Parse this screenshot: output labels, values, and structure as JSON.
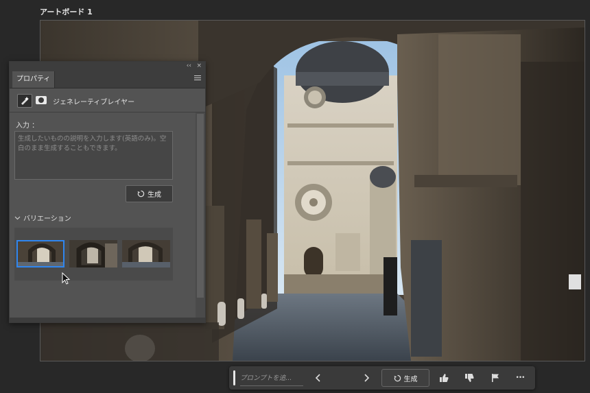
{
  "artboard": {
    "title": "アートボード 1"
  },
  "panel": {
    "tab_label": "プロパティ",
    "collapse_glyph": "‹‹",
    "close_glyph": "×",
    "layer_name": "ジェネレーティブレイヤー",
    "input_label": "入力 ：",
    "prompt_placeholder": "生成したいものの説明を入力します(英語のみ)。空白のまま生成することもできます。",
    "generate_label": "生成",
    "variations_label": "バリエーション",
    "variations": [
      {
        "selected": true
      },
      {
        "selected": false
      },
      {
        "selected": false
      }
    ]
  },
  "taskbar": {
    "prompt_placeholder": "プロンプトを追...",
    "generate_label": "生成",
    "more_glyph": "•••"
  },
  "colors": {
    "accent": "#2f86f0",
    "panel_bg": "#535353",
    "app_bg": "#282828"
  }
}
